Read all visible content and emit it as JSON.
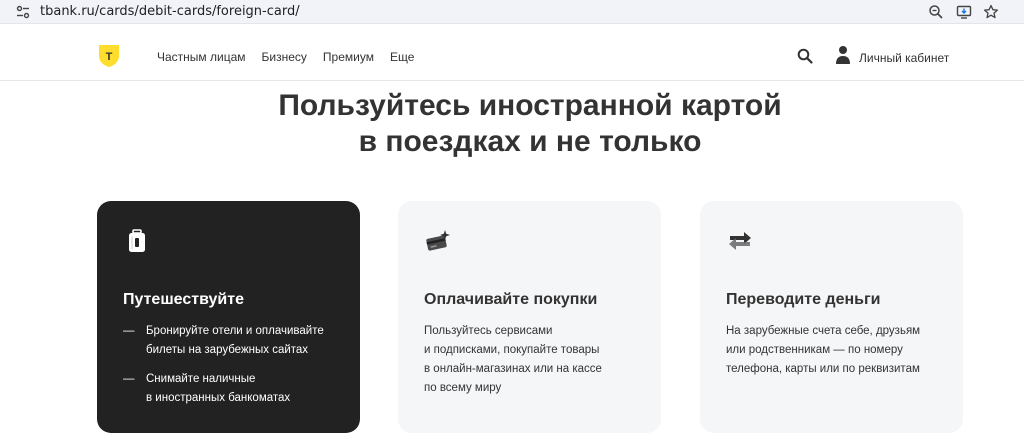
{
  "browser": {
    "url": "tbank.ru/cards/debit-cards/foreign-card/"
  },
  "header": {
    "logo_text": "T",
    "nav": [
      {
        "label": "Частным лицам"
      },
      {
        "label": "Бизнесу"
      },
      {
        "label": "Премиум"
      },
      {
        "label": "Еще"
      }
    ],
    "account_label": "Личный кабинет"
  },
  "hero": {
    "title_line1": "Пользуйтесь иностранной картой",
    "title_line2": "в поездках и не только"
  },
  "cards": [
    {
      "icon": "luggage-icon",
      "title": "Путешествуйте",
      "bullets": [
        {
          "line1": "Бронируйте отели и оплачивайте",
          "line2": "билеты на зарубежных сайтах"
        },
        {
          "line1": "Снимайте наличные",
          "line2": "в иностранных банкоматах"
        }
      ]
    },
    {
      "icon": "card-sparkle-icon",
      "title": "Оплачивайте покупки",
      "lines": [
        "Пользуйтесь сервисами",
        "и подписками, покупайте товары",
        "в онлайн-магазинах или на кассе",
        "по всему миру"
      ]
    },
    {
      "icon": "transfer-arrows-icon",
      "title": "Переводите деньги",
      "lines": [
        "На зарубежные счета себе, друзьям",
        "или родственникам — по номеру",
        "телефона, карты или по реквизитам"
      ]
    }
  ],
  "colors": {
    "brand_yellow": "#ffdd2d",
    "dark_card": "#222222",
    "light_card": "#f5f6f8",
    "text": "#333333"
  }
}
